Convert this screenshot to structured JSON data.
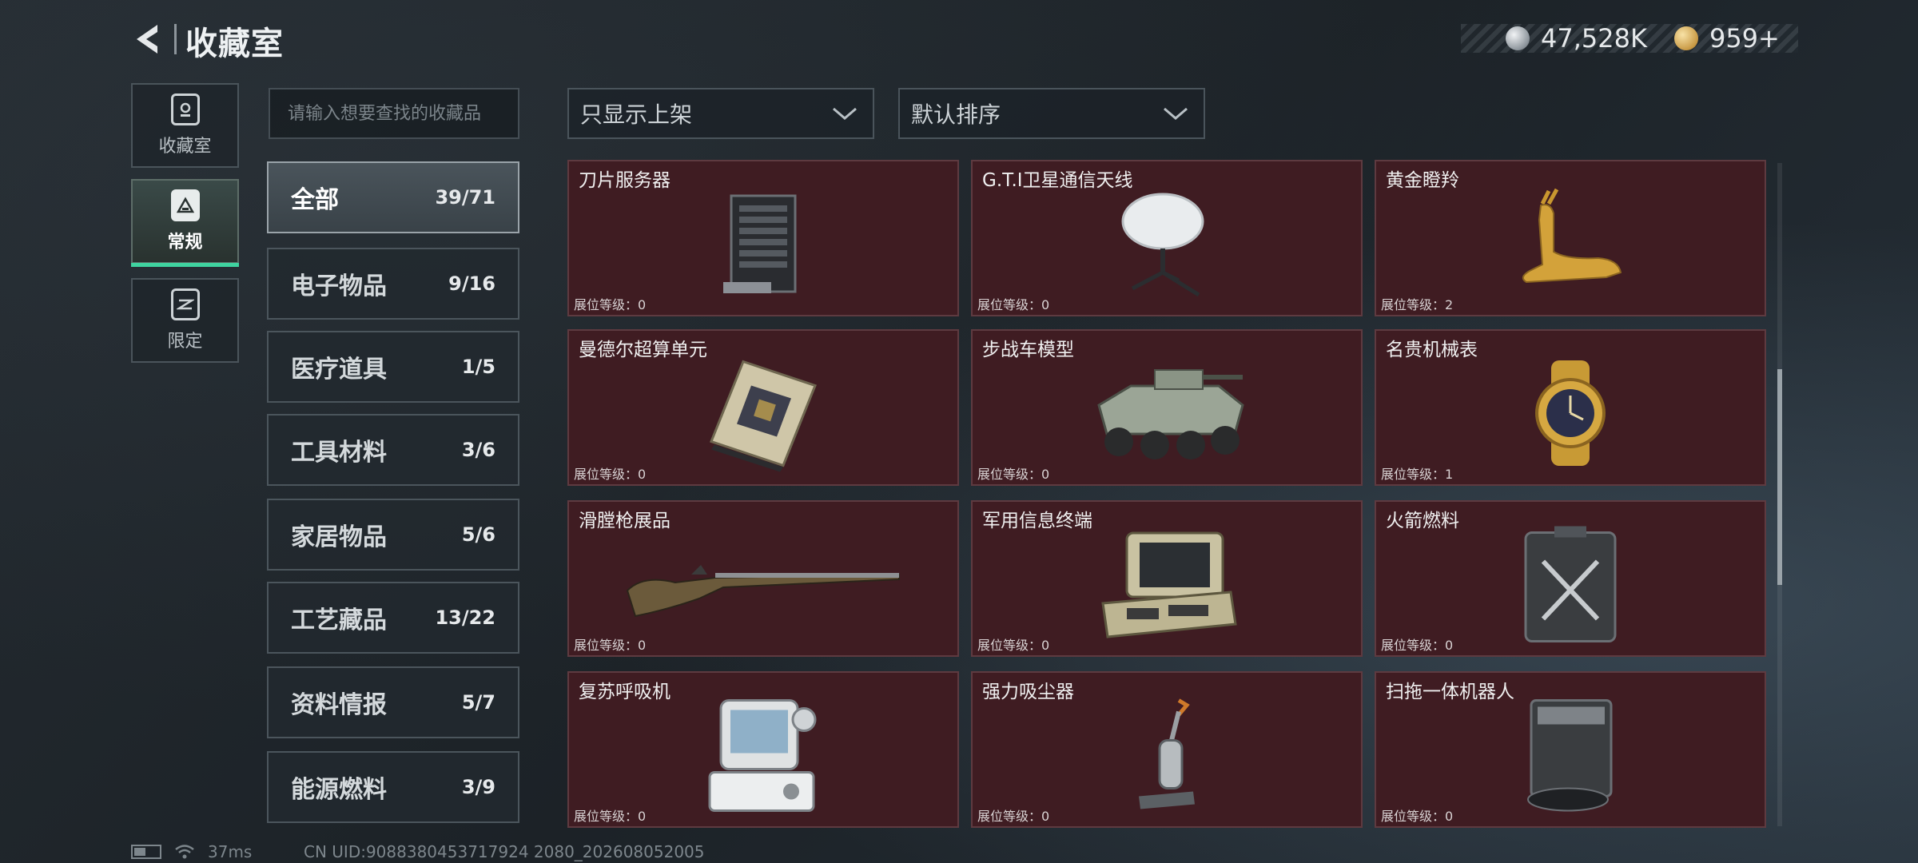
{
  "header": {
    "title": "收藏室",
    "currency": [
      {
        "icon": "silver-coin-icon",
        "value": "47,528K"
      },
      {
        "icon": "gold-coin-icon",
        "value": "959+"
      }
    ]
  },
  "sidenav": [
    {
      "label": "收藏室",
      "icon": "collection-room-icon",
      "active": false
    },
    {
      "label": "常规",
      "icon": "regular-icon",
      "active": true
    },
    {
      "label": "限定",
      "icon": "limited-icon",
      "active": false
    }
  ],
  "search": {
    "placeholder": "请输入想要查找的收藏品"
  },
  "filters": {
    "display": "只显示上架",
    "sort": "默认排序"
  },
  "categories": [
    {
      "name": "全部",
      "count": "39/71",
      "active": true
    },
    {
      "name": "电子物品",
      "count": "9/16"
    },
    {
      "name": "医疗道具",
      "count": "1/5"
    },
    {
      "name": "工具材料",
      "count": "3/6"
    },
    {
      "name": "家居物品",
      "count": "5/6"
    },
    {
      "name": "工艺藏品",
      "count": "13/22"
    },
    {
      "name": "资料情报",
      "count": "5/7"
    },
    {
      "name": "能源燃料",
      "count": "3/9"
    }
  ],
  "items": [
    {
      "name": "刀片服务器",
      "level": "展位等级：0",
      "icon": "blade-server-icon"
    },
    {
      "name": "G.T.I卫星通信天线",
      "level": "展位等级：0",
      "icon": "satellite-antenna-icon"
    },
    {
      "name": "黄金瞪羚",
      "level": "展位等级：2",
      "icon": "golden-gazelle-icon"
    },
    {
      "name": "曼德尔超算单元",
      "level": "展位等级：0",
      "icon": "supercomputer-unit-icon"
    },
    {
      "name": "步战车模型",
      "level": "展位等级：0",
      "icon": "ifv-model-icon"
    },
    {
      "name": "名贵机械表",
      "level": "展位等级：1",
      "icon": "mechanical-watch-icon"
    },
    {
      "name": "滑膛枪展品",
      "level": "展位等级：0",
      "icon": "musket-icon"
    },
    {
      "name": "军用信息终端",
      "level": "展位等级：0",
      "icon": "military-terminal-icon"
    },
    {
      "name": "火箭燃料",
      "level": "展位等级：0",
      "icon": "rocket-fuel-icon"
    },
    {
      "name": "复苏呼吸机",
      "level": "展位等级：0",
      "icon": "ventilator-icon"
    },
    {
      "name": "强力吸尘器",
      "level": "展位等级：0",
      "icon": "vacuum-cleaner-icon"
    },
    {
      "name": "扫拖一体机器人",
      "level": "展位等级：0",
      "icon": "robot-mop-icon"
    }
  ],
  "status": {
    "ping": "37ms",
    "uid": "CN UID:9088380453717924 2080_202608052005"
  },
  "colors": {
    "card_bg": "#3f1c22",
    "active_accent": "#3fd3a0"
  }
}
